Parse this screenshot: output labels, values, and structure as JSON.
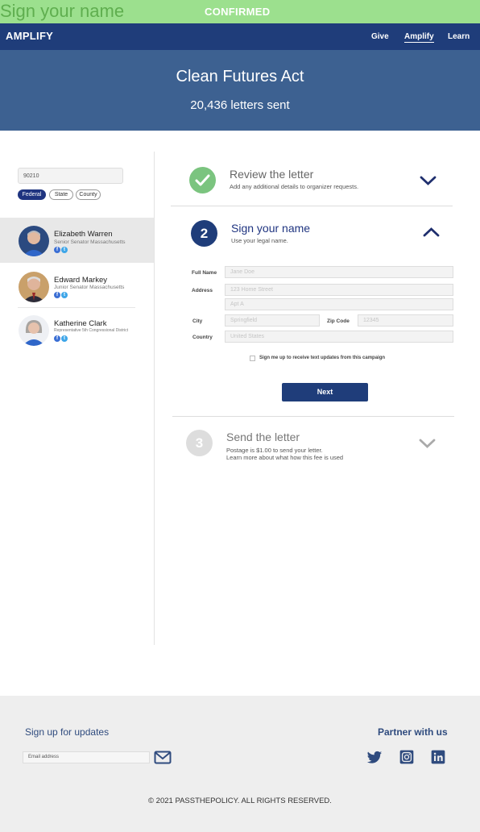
{
  "banner": {
    "label": "Sign your name",
    "status": "CONFIRMED"
  },
  "nav": {
    "logo": "AMPLIFY",
    "links": [
      {
        "label": "Give"
      },
      {
        "label": "Amplify",
        "active": true
      },
      {
        "label": "Learn"
      }
    ]
  },
  "hero": {
    "title": "Clean Futures Act",
    "count": "20,436 letters sent"
  },
  "sidebar": {
    "zip_value": "90210",
    "filters": [
      "Federal",
      "State",
      "County"
    ],
    "active_filter": "Federal",
    "reps": [
      {
        "name": "Elizabeth Warren",
        "role": "Senior Senator Massachusetts"
      },
      {
        "name": "Edward Markey",
        "role": "Junior Senator Massachusetts"
      },
      {
        "name": "Katherine Clark",
        "role": "Representative 5th Congressional District"
      }
    ]
  },
  "steps": {
    "review": {
      "title": "Review the letter",
      "subtitle": "Add any additional details to organizer requests."
    },
    "sign": {
      "number": "2",
      "title": "Sign your name",
      "subtitle": "Use your legal name."
    },
    "send": {
      "number": "3",
      "title": "Send the letter",
      "subtitle1": "Postage is $1.00 to send your letter.",
      "subtitle2": "Learn more about what how this fee is used"
    }
  },
  "form": {
    "full_name_label": "Full Name",
    "full_name_placeholder": "Jane Doe",
    "address_label": "Address",
    "address1_placeholder": "123 Home Street",
    "address2_placeholder": "Apt A",
    "city_label": "City",
    "city_placeholder": "Springfield",
    "zip_label": "Zip Code",
    "zip_placeholder": "12345",
    "country_label": "Country",
    "country_placeholder": "United States",
    "sms_optin_label": "Sign me up to receive text updates from this campaign",
    "next_label": "Next"
  },
  "footer": {
    "signup_title": "Sign up for updates",
    "email_placeholder": "Email address",
    "partner_title": "Partner with us",
    "copyright": "© 2021 PASSTHEPOLICY. ALL RIGHTS RESERVED."
  },
  "colors": {
    "navy": "#1f3d7a",
    "hero": "#3d6191",
    "success": "#7bc47f",
    "banner": "#9ce08e"
  }
}
